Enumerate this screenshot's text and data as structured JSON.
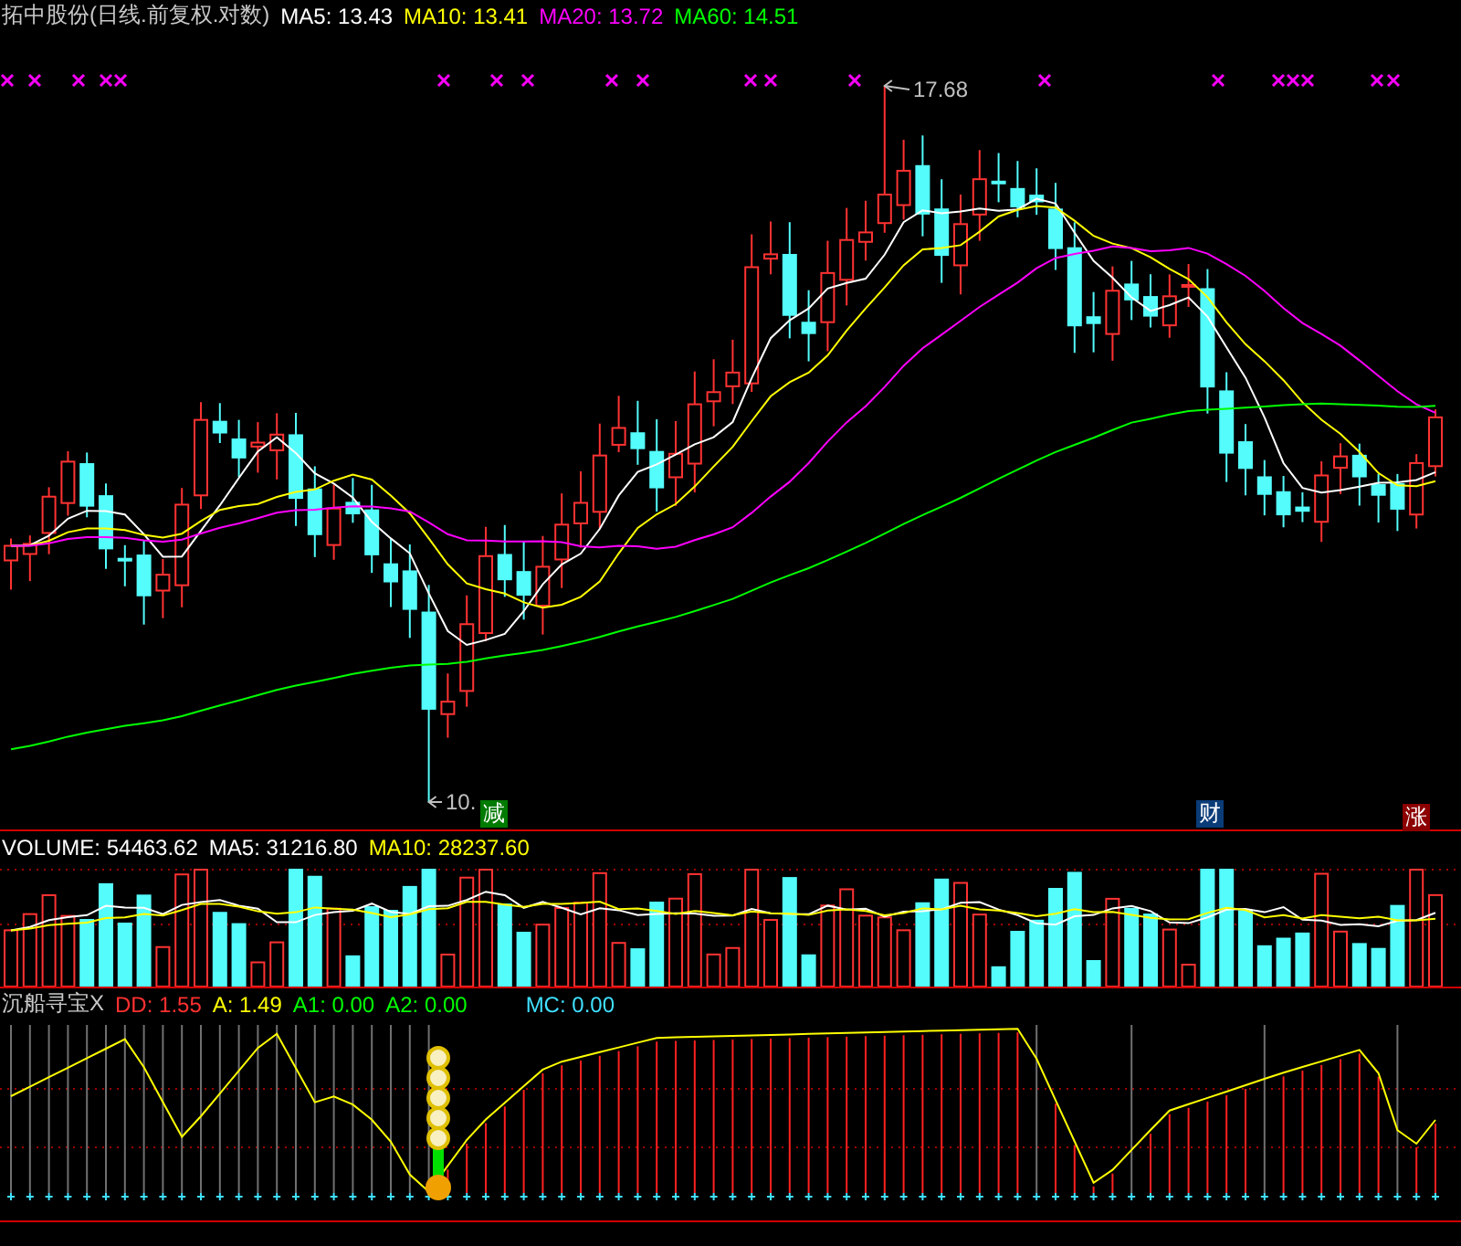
{
  "header": {
    "title": "拓中股份(日线.前复权.对数)",
    "indicators": [
      {
        "label": "MA5: 13.43",
        "color": "#ffffff"
      },
      {
        "label": "MA10: 13.41",
        "color": "#ffff00"
      },
      {
        "label": "MA20: 13.72",
        "color": "#ff00ff"
      },
      {
        "label": "MA60: 14.51",
        "color": "#00ff00"
      }
    ]
  },
  "price_chart": {
    "high_label": "17.68",
    "low_label": "10.",
    "badges": [
      {
        "text": "减",
        "color": "#007a00"
      },
      {
        "text": "财",
        "color": "#0a3c78"
      },
      {
        "text": "涨",
        "color": "#8c0000"
      }
    ]
  },
  "volume_panel": {
    "legend": [
      {
        "label": "VOLUME: 54463.62",
        "color": "#ffffff"
      },
      {
        "label": "MA5: 31216.80",
        "color": "#ffffff"
      },
      {
        "label": "MA10: 28237.60",
        "color": "#ffff00"
      }
    ]
  },
  "indicator_panel": {
    "title": "沉船寻宝X",
    "legend": [
      {
        "label": "DD: 1.55",
        "color": "#ff3030"
      },
      {
        "label": "A: 1.49",
        "color": "#ffff00"
      },
      {
        "label": "A1: 0.00",
        "color": "#00ff00"
      },
      {
        "label": "A2: 0.00",
        "color": "#00ff00"
      },
      {
        "label": "MC: 0.00",
        "color": "#40e0ff"
      }
    ]
  }
}
